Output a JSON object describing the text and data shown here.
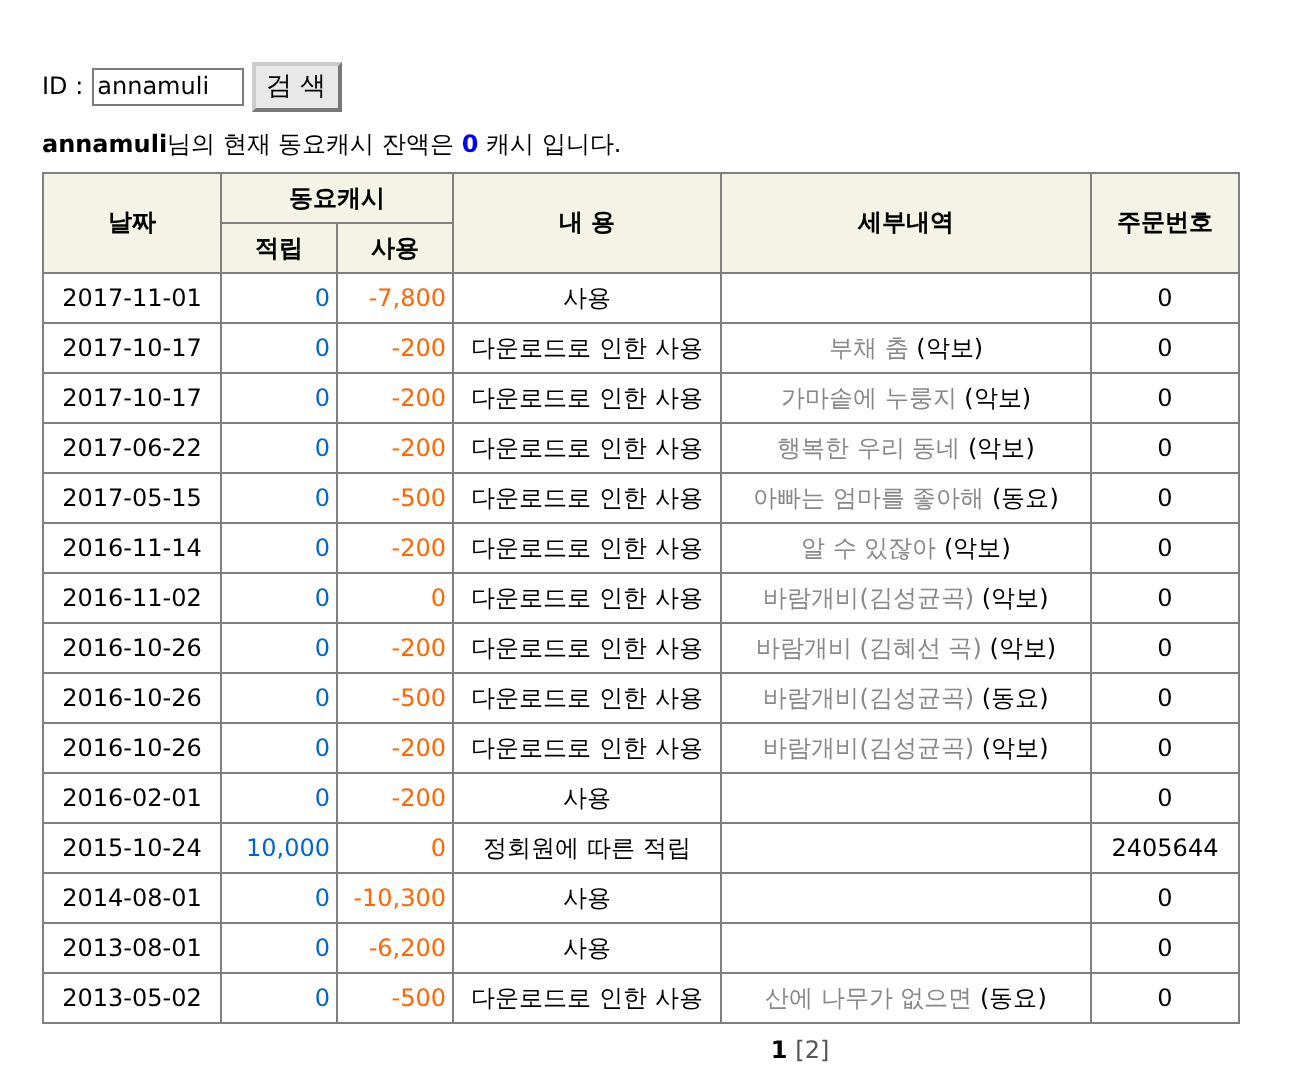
{
  "search": {
    "label": "ID :",
    "value": "annamuli",
    "button": "검 색"
  },
  "balance": {
    "user": "annamuli",
    "text_before": "님의 현재 동요캐시 잔액은",
    "amount": "0",
    "text_after": "캐시 입니다."
  },
  "table": {
    "columns": {
      "date": "날짜",
      "cash": "동요캐시",
      "earned": "적립",
      "used": "사용",
      "content": "내 용",
      "details": "세부내역",
      "order_no": "주문번호"
    },
    "rows": [
      {
        "date": "2017-11-01",
        "earned": "0",
        "used": "-7,800",
        "content": "사용",
        "order_no": "0"
      },
      {
        "date": "2017-10-17",
        "earned": "0",
        "used": "-200",
        "content": "다운로드로 인한 사용",
        "detail_title": "부채 춤",
        "detail_type": "(악보)",
        "order_no": "0"
      },
      {
        "date": "2017-10-17",
        "earned": "0",
        "used": "-200",
        "content": "다운로드로 인한 사용",
        "detail_title": "가마솥에 누룽지",
        "detail_type": "(악보)",
        "order_no": "0"
      },
      {
        "date": "2017-06-22",
        "earned": "0",
        "used": "-200",
        "content": "다운로드로 인한 사용",
        "detail_title": "행복한 우리 동네",
        "detail_type": "(악보)",
        "order_no": "0"
      },
      {
        "date": "2017-05-15",
        "earned": "0",
        "used": "-500",
        "content": "다운로드로 인한 사용",
        "detail_title": "아빠는 엄마를 좋아해",
        "detail_type": "(동요)",
        "order_no": "0"
      },
      {
        "date": "2016-11-14",
        "earned": "0",
        "used": "-200",
        "content": "다운로드로 인한 사용",
        "detail_title": "알 수 있잖아",
        "detail_type": "(악보)",
        "order_no": "0"
      },
      {
        "date": "2016-11-02",
        "earned": "0",
        "used": "0",
        "content": "다운로드로 인한 사용",
        "detail_title": "바람개비(김성균곡)",
        "detail_type": "(악보)",
        "order_no": "0"
      },
      {
        "date": "2016-10-26",
        "earned": "0",
        "used": "-200",
        "content": "다운로드로 인한 사용",
        "detail_title": "바람개비 (김혜선 곡)",
        "detail_type": "(악보)",
        "order_no": "0"
      },
      {
        "date": "2016-10-26",
        "earned": "0",
        "used": "-500",
        "content": "다운로드로 인한 사용",
        "detail_title": "바람개비(김성균곡)",
        "detail_type": "(동요)",
        "order_no": "0"
      },
      {
        "date": "2016-10-26",
        "earned": "0",
        "used": "-200",
        "content": "다운로드로 인한 사용",
        "detail_title": "바람개비(김성균곡)",
        "detail_type": "(악보)",
        "order_no": "0"
      },
      {
        "date": "2016-02-01",
        "earned": "0",
        "used": "-200",
        "content": "사용",
        "order_no": "0"
      },
      {
        "date": "2015-10-24",
        "earned": "10,000",
        "used": "0",
        "content": "정회원에 따른 적립",
        "order_no": "2405644"
      },
      {
        "date": "2014-08-01",
        "earned": "0",
        "used": "-10,300",
        "content": "사용",
        "order_no": "0"
      },
      {
        "date": "2013-08-01",
        "earned": "0",
        "used": "-6,200",
        "content": "사용",
        "order_no": "0"
      },
      {
        "date": "2013-05-02",
        "earned": "0",
        "used": "-500",
        "content": "다운로드로 인한 사용",
        "detail_title": "산에 나무가 없으면",
        "detail_type": "(동요)",
        "order_no": "0"
      }
    ]
  },
  "pagination": [
    {
      "label": "1",
      "selected": true
    },
    {
      "label": "[2]",
      "selected": false
    }
  ]
}
